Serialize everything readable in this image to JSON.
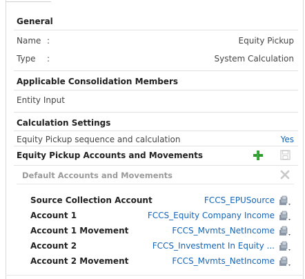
{
  "general": {
    "header": "General",
    "name_label": "Name",
    "name_colon": ":",
    "name_value": "Equity Pickup",
    "type_label": "Type",
    "type_colon": ":",
    "type_value": "System Calculation"
  },
  "consolidation": {
    "header": "Applicable Consolidation Members",
    "member": "Entity Input"
  },
  "calc_settings": {
    "header": "Calculation Settings",
    "label": "Equity Pickup sequence and calculation",
    "value": "Yes"
  },
  "accounts_movements": {
    "header": "Equity Pickup Accounts and Movements",
    "default_header": "Default Accounts and Movements",
    "rows": [
      {
        "label": "Source Collection Account",
        "value": "FCCS_EPUSource"
      },
      {
        "label": "Account 1",
        "value": "FCCS_Equity Company Income"
      },
      {
        "label": "Account 1 Movement",
        "value": "FCCS_Mvmts_NetIncome"
      },
      {
        "label": "Account 2",
        "value": "FCCS_Investment In Equity ..."
      },
      {
        "label": "Account 2 Movement",
        "value": "FCCS_Mvmts_NetIncome"
      }
    ]
  },
  "colors": {
    "link": "#1565b8",
    "add_icon": "#2e9b2e",
    "disabled_icon": "#c8c8c8"
  },
  "icons": {
    "add": "plus-icon",
    "save": "save-icon",
    "remove": "close-icon",
    "member_selector": "member-selector-icon"
  }
}
